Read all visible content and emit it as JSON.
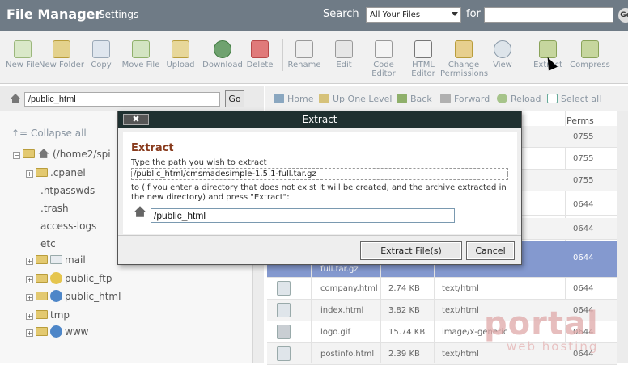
{
  "header": {
    "title": "File Manager",
    "settings_label": "Settings",
    "search_label": "Search",
    "search_scope": "All Your Files",
    "for_label": "for",
    "search_value": "",
    "go_circle": "Go"
  },
  "toolbar": {
    "items": [
      {
        "label": "New File",
        "icon": "new-file-icon"
      },
      {
        "label": "New Folder",
        "icon": "new-folder-icon"
      },
      {
        "label": "Copy",
        "icon": "copy-icon"
      },
      {
        "label": "Move File",
        "icon": "move-file-icon"
      },
      {
        "label": "Upload",
        "icon": "upload-icon"
      },
      {
        "label": "Download",
        "icon": "download-icon"
      },
      {
        "label": "Delete",
        "icon": "delete-icon"
      },
      {
        "label": "Rename",
        "icon": "rename-icon"
      },
      {
        "label": "Edit",
        "icon": "edit-icon"
      },
      {
        "label": "Code Editor",
        "icon": "code-editor-icon"
      },
      {
        "label": "HTML Editor",
        "icon": "html-editor-icon"
      },
      {
        "label": "Change Permissions",
        "icon": "permissions-icon"
      },
      {
        "label": "View",
        "icon": "view-icon"
      },
      {
        "label": "Extract",
        "icon": "extract-icon"
      },
      {
        "label": "Compress",
        "icon": "compress-icon"
      }
    ]
  },
  "pathbar": {
    "value": "/public_html",
    "go_label": "Go"
  },
  "navbar": {
    "home": "Home",
    "up": "Up One Level",
    "back": "Back",
    "forward": "Forward",
    "reload": "Reload",
    "select_all": "Select all"
  },
  "tree": {
    "collapse_all": "Collapse all",
    "root": "(/home2/spi",
    "items": [
      ".cpanel",
      ".htpasswds",
      ".trash",
      "access-logs",
      "etc",
      "mail",
      "public_ftp",
      "public_html",
      "tmp",
      "www"
    ]
  },
  "list": {
    "perms_header": "Perms",
    "rows": [
      {
        "name": "",
        "size": "",
        "type": "",
        "perms": "0755"
      },
      {
        "name": "",
        "size": "",
        "type": "",
        "perms": "0755"
      },
      {
        "name": "",
        "size": "",
        "type": "",
        "perms": "0755"
      },
      {
        "name": "",
        "size": "",
        "type": "",
        "perms": "0644"
      },
      {
        "name": "",
        "size": "",
        "type": "",
        "perms": "0644"
      },
      {
        "name": "full.tar.gz",
        "size": "",
        "type": "",
        "perms": "0644"
      },
      {
        "name": "company.html",
        "size": "2.74 KB",
        "type": "text/html",
        "perms": "0644"
      },
      {
        "name": "index.html",
        "size": "3.82 KB",
        "type": "text/html",
        "perms": "0644"
      },
      {
        "name": "logo.gif",
        "size": "15.74 KB",
        "type": "image/x-generic",
        "perms": "0644"
      },
      {
        "name": "postinfo.html",
        "size": "2.39 KB",
        "type": "text/html",
        "perms": "0644"
      }
    ]
  },
  "dialog": {
    "title": "Extract",
    "close_label": "✖",
    "heading": "Extract",
    "prompt": "Type the path you wish to extract",
    "file": "/public_html/cmsmadesimple-1.5.1-full.tar.gz",
    "note": "to (if you enter a directory that does not exist it will be created, and the archive extracted in the new directory) and press \"Extract\":",
    "target_path": "/public_html",
    "extract_button": "Extract File(s)",
    "cancel_button": "Cancel"
  },
  "watermark": {
    "brand": "portal",
    "sub": "web hosting"
  },
  "colors": {
    "header": "#6f7b86",
    "dialog_bar": "#1f3030",
    "selected_row": "#8499cf",
    "heading": "#883a1c"
  }
}
